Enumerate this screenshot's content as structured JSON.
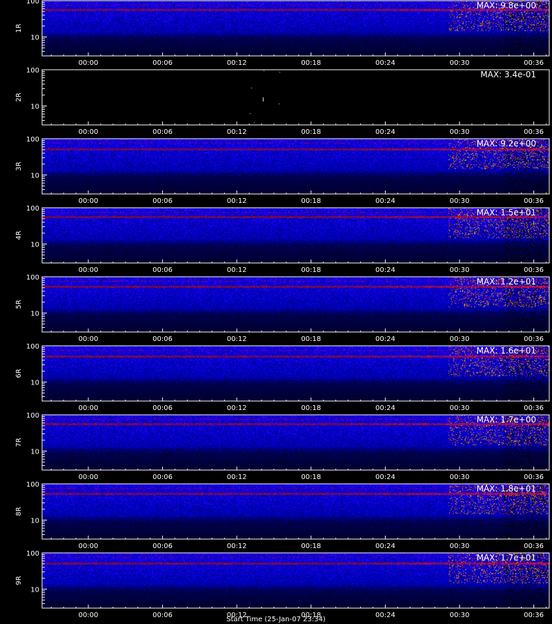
{
  "chart_data": {
    "type": "heatmap",
    "y_scale": "log",
    "ylim": [
      3,
      100
    ],
    "y_tick_labels": [
      "100",
      "10"
    ],
    "x_tick_labels": [
      "00:00",
      "00:06",
      "00:12",
      "00:18",
      "00:24",
      "00:30",
      "00:36"
    ],
    "footer_text": "Start Time (25-Jan-07 23:34)",
    "colors": {
      "background": "#000000",
      "low": "#1a1acc",
      "mid": "#3030ff",
      "high": "#ff2a00",
      "peak": "#ffd800",
      "axes": "#ffffff"
    },
    "panels": [
      {
        "label": "1R",
        "max_text": "MAX: 9.8e+00",
        "max": 9.8
      },
      {
        "label": "2R",
        "max_text": "MAX: 3.4e-01",
        "max": 0.34
      },
      {
        "label": "3R",
        "max_text": "MAX: 9.2e+00",
        "max": 9.2
      },
      {
        "label": "4R",
        "max_text": "MAX: 1.5e+01",
        "max": 15
      },
      {
        "label": "5R",
        "max_text": "MAX: 1.2e+01",
        "max": 12
      },
      {
        "label": "6R",
        "max_text": "MAX: 1.6e+01",
        "max": 16
      },
      {
        "label": "7R",
        "max_text": "MAX: 1.7e+00",
        "max": 1.7
      },
      {
        "label": "8R",
        "max_text": "MAX: 1.8e+01",
        "max": 18
      },
      {
        "label": "9R",
        "max_text": "MAX: 1.7e+01",
        "max": 17
      }
    ]
  }
}
